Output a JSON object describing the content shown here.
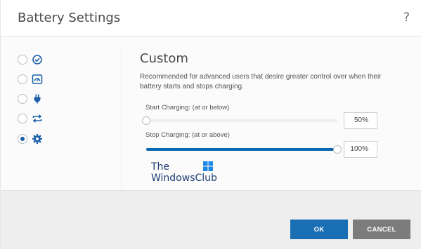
{
  "dialog": {
    "title": "Battery Settings",
    "help_label": "?"
  },
  "sidebar": {
    "options": [
      {
        "icon": "check-circle-icon",
        "selected": false
      },
      {
        "icon": "gauge-icon",
        "selected": false
      },
      {
        "icon": "plug-icon",
        "selected": false
      },
      {
        "icon": "cycle-arrows-icon",
        "selected": false
      },
      {
        "icon": "gear-icon",
        "selected": true
      }
    ]
  },
  "main": {
    "section_title": "Custom",
    "description": "Recommended for advanced users that desire greater control over when their battery starts and stops charging.",
    "start_charging": {
      "label": "Start Charging: (at or below)",
      "value_percent": 50,
      "value_text": "50%"
    },
    "stop_charging": {
      "label": "Stop Charging: (at or above)",
      "value_percent": 100,
      "value_text": "100%"
    }
  },
  "watermark": {
    "line1": "The",
    "line2": "WindowsClub"
  },
  "footer": {
    "ok_label": "OK",
    "cancel_label": "CANCEL"
  },
  "colors": {
    "accent": "#0a66b1",
    "ok_button": "#1a6fb4",
    "cancel_button": "#7c7c7c"
  }
}
